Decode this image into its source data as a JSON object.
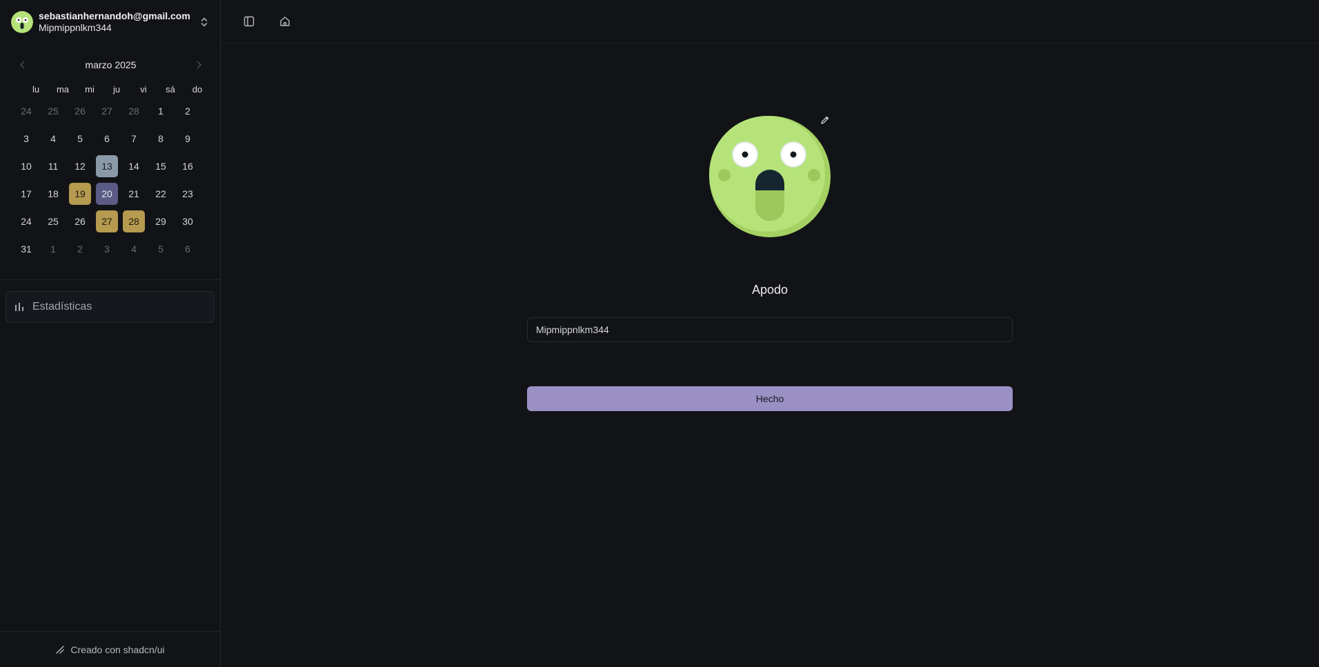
{
  "user": {
    "email": "sebastianhernandoh@gmail.com",
    "nickname": "Mipmippnlkm344"
  },
  "calendar": {
    "month_label": "marzo 2025",
    "weekdays": [
      "lu",
      "ma",
      "mi",
      "ju",
      "vi",
      "sá",
      "do"
    ],
    "weeks": [
      [
        {
          "d": "24",
          "m": true
        },
        {
          "d": "25",
          "m": true
        },
        {
          "d": "26",
          "m": true
        },
        {
          "d": "27",
          "m": true
        },
        {
          "d": "28",
          "m": true
        },
        {
          "d": "1"
        },
        {
          "d": "2"
        }
      ],
      [
        {
          "d": "3"
        },
        {
          "d": "4"
        },
        {
          "d": "5"
        },
        {
          "d": "6"
        },
        {
          "d": "7"
        },
        {
          "d": "8"
        },
        {
          "d": "9"
        }
      ],
      [
        {
          "d": "10"
        },
        {
          "d": "11"
        },
        {
          "d": "12"
        },
        {
          "d": "13",
          "s": "gray"
        },
        {
          "d": "14"
        },
        {
          "d": "15"
        },
        {
          "d": "16"
        }
      ],
      [
        {
          "d": "17"
        },
        {
          "d": "18"
        },
        {
          "d": "19",
          "s": "gold"
        },
        {
          "d": "20",
          "s": "blue"
        },
        {
          "d": "21"
        },
        {
          "d": "22"
        },
        {
          "d": "23"
        }
      ],
      [
        {
          "d": "24"
        },
        {
          "d": "25"
        },
        {
          "d": "26"
        },
        {
          "d": "27",
          "s": "gold"
        },
        {
          "d": "28",
          "s": "gold"
        },
        {
          "d": "29"
        },
        {
          "d": "30"
        }
      ],
      [
        {
          "d": "31"
        },
        {
          "d": "1",
          "m": true
        },
        {
          "d": "2",
          "m": true
        },
        {
          "d": "3",
          "m": true
        },
        {
          "d": "4",
          "m": true
        },
        {
          "d": "5",
          "m": true
        },
        {
          "d": "6",
          "m": true
        }
      ]
    ]
  },
  "nav": {
    "stats_label": "Estadísticas",
    "stats_icon": "bar-chart-icon"
  },
  "footer": {
    "text": "Creado con shadcn/ui"
  },
  "profile": {
    "field_label": "Apodo",
    "nickname_value": "Mipmippnlkm344",
    "done_label": "Hecho"
  },
  "colors": {
    "accent_button": "#9a90c4",
    "selected_gold": "#b59a4f",
    "selected_blue": "#5b5b85",
    "selected_gray": "#8a9aa8",
    "avatar_green": "#b5e37a"
  }
}
